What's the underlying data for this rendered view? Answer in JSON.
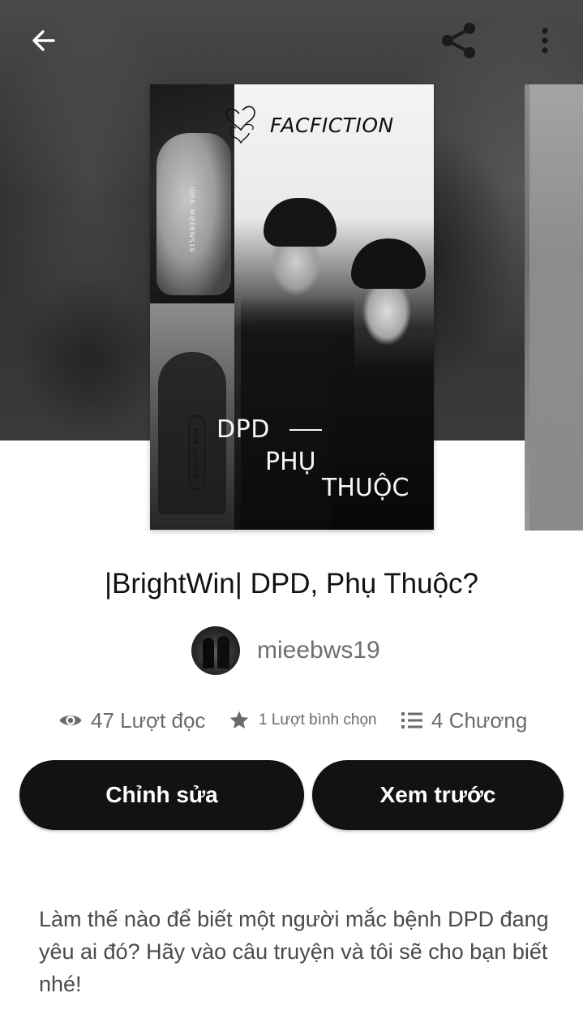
{
  "header": {
    "back_icon": "arrow-left-icon",
    "share_icon": "share-icon",
    "more_icon": "more-vertical-icon"
  },
  "cover": {
    "header_text": "FACFICTION",
    "idea_text": "IDEA: MIEEBWS19",
    "pill_text": "BRIGHT WIN",
    "line1": "DPD",
    "line2": "PHỤ",
    "line3": "THUỘC"
  },
  "story": {
    "title": "|BrightWin| DPD, Phụ Thuộc?",
    "author": "mieebws19",
    "description": "Làm thế nào để biết một người mắc bệnh DPD đang yêu ai đó? Hãy vào câu truyện và tôi sẽ cho bạn biết nhé!"
  },
  "stats": {
    "reads": "47 Lượt đọc",
    "votes": "1 Lượt bình chọn",
    "parts": "4 Chương"
  },
  "actions": {
    "edit_label": "Chỉnh sửa",
    "preview_label": "Xem trước"
  },
  "colors": {
    "button_bg": "#121212",
    "button_text": "#ffffff",
    "muted_text": "#6b6b6b"
  }
}
